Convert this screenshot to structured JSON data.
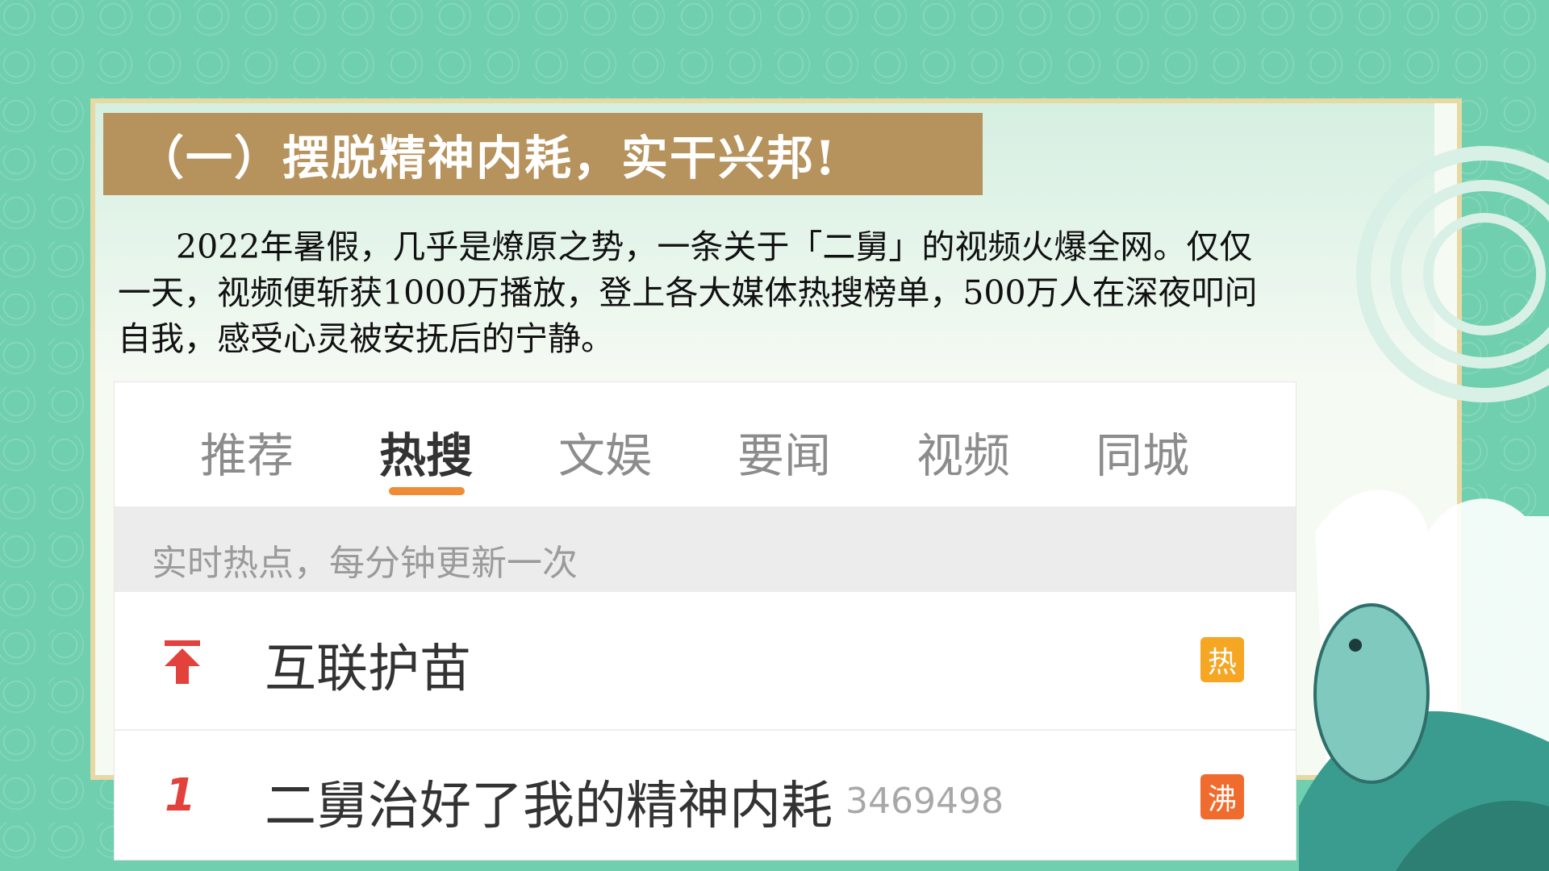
{
  "slide": {
    "title": "（一）摆脱精神内耗，实干兴邦!",
    "paragraph": "2022年暑假，几乎是燎原之势，一条关于「二舅」的视频火爆全网。仅仅一天，视频便斩获1000万播放，登上各大媒体热搜榜单，500万人在深夜叩问自我，感受心灵被安抚后的宁静。"
  },
  "screenshot": {
    "tabs": [
      "推荐",
      "热搜",
      "文娱",
      "要闻",
      "视频",
      "同城"
    ],
    "active_tab": "热搜",
    "subtitle": "实时热点，每分钟更新一次",
    "rows": [
      {
        "rank": "pinned",
        "rank_icon": "arrow-up-icon",
        "title": "互联护苗",
        "count": "",
        "badge": "热"
      },
      {
        "rank": "1",
        "title": "二舅治好了我的精神内耗",
        "count": "3469498",
        "badge": "沸"
      }
    ]
  },
  "colors": {
    "background": "#6fcfae",
    "title_bar": "#b6925c",
    "tab_indicator": "#f08c35",
    "rank_red": "#e3413c",
    "badge_hot": "#f5a623",
    "badge_boil": "#f06c2e"
  }
}
